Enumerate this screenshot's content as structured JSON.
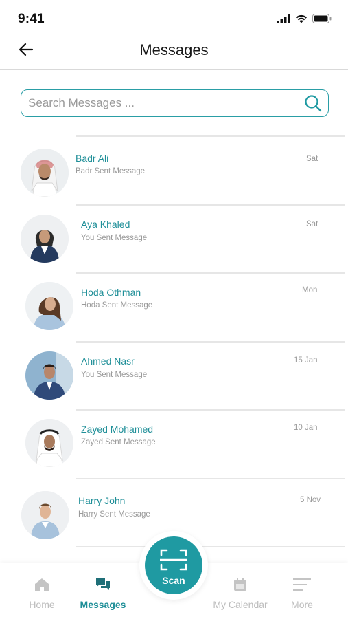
{
  "status_bar": {
    "time": "9:41"
  },
  "header": {
    "title": "Messages"
  },
  "search": {
    "placeholder": "Search Messages ...",
    "value": ""
  },
  "messages": [
    {
      "name": "Badr Ali",
      "preview": "Badr Sent Message",
      "date": "Sat"
    },
    {
      "name": "Aya Khaled",
      "preview": "You Sent Message",
      "date": "Sat"
    },
    {
      "name": "Hoda Othman",
      "preview": "Hoda  Sent Message",
      "date": "Mon"
    },
    {
      "name": "Ahmed Nasr",
      "preview": "You Sent Message",
      "date": "15 Jan"
    },
    {
      "name": "Zayed Mohamed",
      "preview": "Zayed Sent Message",
      "date": "10 Jan"
    },
    {
      "name": "Harry John",
      "preview": "Harry  Sent Message",
      "date": "5 Nov"
    }
  ],
  "scan": {
    "label": "Scan"
  },
  "bottom_nav": [
    {
      "label": "Home",
      "icon": "home-icon"
    },
    {
      "label": "Messages",
      "icon": "chat-icon"
    },
    {
      "label": "My Calendar",
      "icon": "calendar-icon"
    },
    {
      "label": "More",
      "icon": "menu-lines-icon"
    }
  ],
  "colors": {
    "accent": "#1f9aa2",
    "accent_text": "#1f8f98",
    "muted": "#9a9a9a",
    "inactive_nav": "#bdbdbd"
  }
}
